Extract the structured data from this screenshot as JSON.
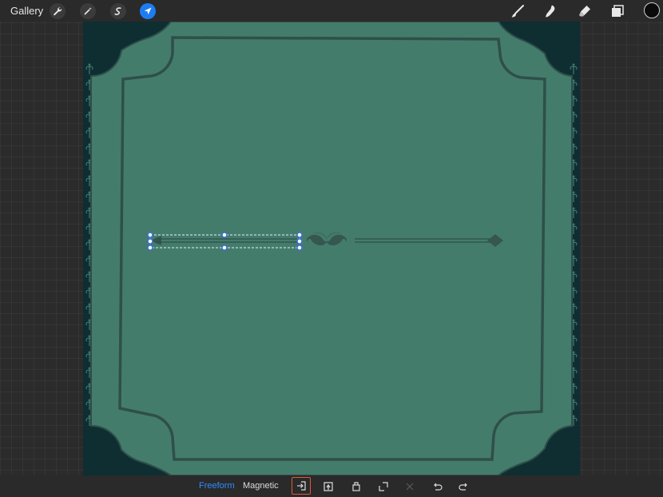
{
  "topbar": {
    "gallery_label": "Gallery",
    "left_tools": [
      {
        "icon": "wrench-icon"
      },
      {
        "icon": "magic-wand-icon"
      },
      {
        "icon": "selection-icon"
      },
      {
        "icon": "transform-arrow-icon",
        "active": true
      }
    ],
    "right_tools": [
      {
        "icon": "brush-icon"
      },
      {
        "icon": "smudge-icon"
      },
      {
        "icon": "eraser-icon"
      },
      {
        "icon": "layers-icon"
      }
    ],
    "current_color": "#0b0b0b"
  },
  "canvas": {
    "background_color": "#0e2e32",
    "frame_fill": "#447c6c",
    "frame_line": "#2f4f49",
    "ornament_color": "#3f7469"
  },
  "bottombar": {
    "freeform_label": "Freeform",
    "magnetic_label": "Magnetic",
    "active_mode": "Freeform",
    "accent_color": "#2f8cff",
    "highlight_color": "#e2583b",
    "buttons": [
      {
        "icon": "fit-to-screen-icon",
        "highlighted": true
      },
      {
        "icon": "flip-horizontal-icon"
      },
      {
        "icon": "rotate-45-icon"
      },
      {
        "icon": "fit-canvas-icon"
      },
      {
        "icon": "reset-icon",
        "disabled": true
      },
      {
        "icon": "undo-icon"
      },
      {
        "icon": "redo-icon"
      }
    ]
  }
}
